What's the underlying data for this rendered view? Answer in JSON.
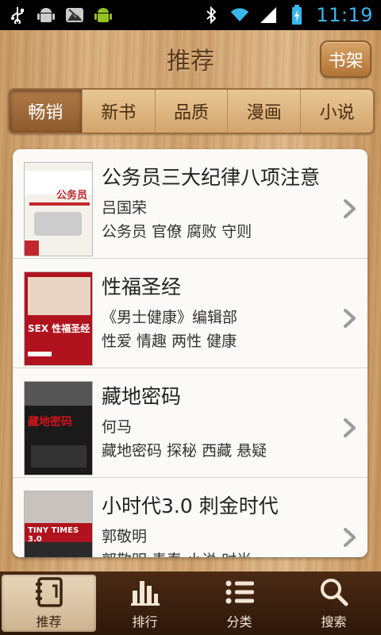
{
  "status_bar": {
    "time": "11:19",
    "icons_left": [
      "usb-icon",
      "android-debug-icon",
      "image-icon",
      "android-icon"
    ],
    "icons_right": [
      "bluetooth-icon",
      "wifi-icon",
      "signal-icon",
      "battery-icon"
    ]
  },
  "header": {
    "title": "推荐",
    "shelf_button": "书架"
  },
  "tabs": [
    {
      "label": "畅销",
      "active": true
    },
    {
      "label": "新书",
      "active": false
    },
    {
      "label": "品质",
      "active": false
    },
    {
      "label": "漫画",
      "active": false
    },
    {
      "label": "小说",
      "active": false
    }
  ],
  "books": [
    {
      "title": "公务员三大纪律八项注意",
      "author": "吕国荣",
      "tags": "公务员 官僚 腐败 守则",
      "cover_text": "公务员"
    },
    {
      "title": "性福圣经",
      "author": "《男士健康》编辑部",
      "tags": "性爱 情趣 两性 健康",
      "cover_text": "SEX 性福圣经"
    },
    {
      "title": "藏地密码",
      "author": "何马",
      "tags": "藏地密码 探秘 西藏 悬疑",
      "cover_text": "藏地密码"
    },
    {
      "title": "小时代3.0 刺金时代",
      "author": "郭敬明",
      "tags": "郭敬明 青春 小说 时尚",
      "cover_text": "TINY TIMES 3.0"
    }
  ],
  "bottom_nav": [
    {
      "label": "推荐",
      "icon": "notebook-icon",
      "active": true
    },
    {
      "label": "排行",
      "icon": "bar-chart-icon",
      "active": false
    },
    {
      "label": "分类",
      "icon": "list-icon",
      "active": false
    },
    {
      "label": "搜索",
      "icon": "search-icon",
      "active": false
    }
  ],
  "colors": {
    "wood": "#d1a46f",
    "tab_active": "#8d5a2c",
    "nav_bg": "#3a2010",
    "time": "#39b6ea"
  }
}
